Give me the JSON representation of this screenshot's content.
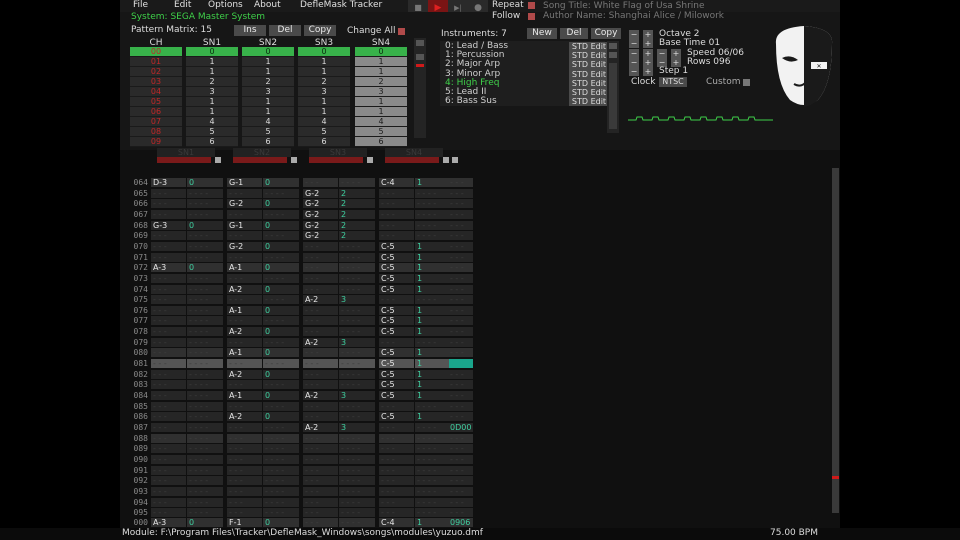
{
  "menu": {
    "file": "File",
    "edit": "Edit",
    "options": "Options",
    "about": "About",
    "app_title": "DefleMask Tracker"
  },
  "transport": {
    "stop": "■",
    "play": "▶",
    "step": "▶|",
    "record": "●"
  },
  "header": {
    "repeat_label": "Repeat",
    "follow_label": "Follow",
    "song_title": "Song Title: White Flag of Usa Shrine",
    "author": "Author Name: Shanghai Alice / Milowork",
    "system": "System: SEGA Master System"
  },
  "matrix": {
    "title": "Pattern Matrix: 15",
    "ins_label": "Ins",
    "del_label": "Del",
    "copy_label": "Copy",
    "change_all": "Change All",
    "headers": [
      "CH",
      "SN1",
      "SN2",
      "SN3",
      "SN4"
    ],
    "rows": [
      [
        "00",
        "0",
        "0",
        "0",
        "0"
      ],
      [
        "01",
        "1",
        "1",
        "1",
        "1"
      ],
      [
        "02",
        "1",
        "1",
        "1",
        "1"
      ],
      [
        "03",
        "2",
        "2",
        "2",
        "2"
      ],
      [
        "04",
        "3",
        "3",
        "3",
        "3"
      ],
      [
        "05",
        "1",
        "1",
        "1",
        "1"
      ],
      [
        "06",
        "1",
        "1",
        "1",
        "1"
      ],
      [
        "07",
        "4",
        "4",
        "4",
        "4"
      ],
      [
        "08",
        "5",
        "5",
        "5",
        "5"
      ],
      [
        "09",
        "6",
        "6",
        "6",
        "6"
      ]
    ]
  },
  "instruments": {
    "title": "Instruments: 7",
    "new_label": "New",
    "del_label": "Del",
    "copy_label": "Copy",
    "items": [
      {
        "name": "0: Lead / Bass",
        "edit": "STD Edit"
      },
      {
        "name": "1: Percussion",
        "edit": "STD Edit"
      },
      {
        "name": "2: Major Arp",
        "edit": "STD Edit"
      },
      {
        "name": "3: Minor Arp",
        "edit": "STD Edit"
      },
      {
        "name": "4: High Freq",
        "edit": "STD Edit"
      },
      {
        "name": "5: Lead II",
        "edit": "STD Edit"
      },
      {
        "name": "6: Bass Sus",
        "edit": "STD Edit"
      }
    ]
  },
  "controls": {
    "octave": "Octave 2",
    "base_time": "Base Time 01",
    "speed": "Speed 06/06",
    "rows": "Rows 096",
    "step": "Step 1",
    "clock_label": "Clock",
    "clock_value": "NTSC",
    "custom_label": "Custom"
  },
  "channels": [
    "SN1",
    "SN2",
    "SN3",
    "SN4"
  ],
  "pattern": {
    "rows": [
      {
        "n": "064",
        "c": [
          [
            "D-3",
            "0"
          ],
          [
            "G-1",
            "0"
          ],
          [
            "",
            ""
          ],
          [
            "C-4",
            "1"
          ]
        ]
      },
      {
        "n": "065",
        "c": [
          [
            "",
            ""
          ],
          [
            "",
            ""
          ],
          [
            "G-2",
            "2"
          ],
          [
            "",
            ""
          ]
        ]
      },
      {
        "n": "066",
        "c": [
          [
            "",
            ""
          ],
          [
            "G-2",
            "0"
          ],
          [
            "G-2",
            "2"
          ],
          [
            "",
            ""
          ]
        ]
      },
      {
        "n": "067",
        "c": [
          [
            "",
            ""
          ],
          [
            "",
            ""
          ],
          [
            "G-2",
            "2"
          ],
          [
            "",
            ""
          ]
        ]
      },
      {
        "n": "068",
        "c": [
          [
            "G-3",
            "0"
          ],
          [
            "G-1",
            "0"
          ],
          [
            "G-2",
            "2"
          ],
          [
            "",
            ""
          ]
        ]
      },
      {
        "n": "069",
        "c": [
          [
            "",
            ""
          ],
          [
            "",
            ""
          ],
          [
            "G-2",
            "2"
          ],
          [
            "",
            ""
          ]
        ]
      },
      {
        "n": "070",
        "c": [
          [
            "",
            ""
          ],
          [
            "G-2",
            "0"
          ],
          [
            "",
            ""
          ],
          [
            "C-5",
            "1"
          ]
        ]
      },
      {
        "n": "071",
        "c": [
          [
            "",
            ""
          ],
          [
            "",
            ""
          ],
          [
            "",
            ""
          ],
          [
            "C-5",
            "1"
          ]
        ]
      },
      {
        "n": "072",
        "c": [
          [
            "A-3",
            "0"
          ],
          [
            "A-1",
            "0"
          ],
          [
            "",
            ""
          ],
          [
            "C-5",
            "1"
          ]
        ]
      },
      {
        "n": "073",
        "c": [
          [
            "",
            ""
          ],
          [
            "",
            ""
          ],
          [
            "",
            ""
          ],
          [
            "C-5",
            "1"
          ]
        ]
      },
      {
        "n": "074",
        "c": [
          [
            "",
            ""
          ],
          [
            "A-2",
            "0"
          ],
          [
            "",
            ""
          ],
          [
            "C-5",
            "1"
          ]
        ]
      },
      {
        "n": "075",
        "c": [
          [
            "",
            ""
          ],
          [
            "",
            ""
          ],
          [
            "A-2",
            "3"
          ],
          [
            "",
            ""
          ]
        ]
      },
      {
        "n": "076",
        "c": [
          [
            "",
            ""
          ],
          [
            "A-1",
            "0"
          ],
          [
            "",
            ""
          ],
          [
            "C-5",
            "1"
          ]
        ]
      },
      {
        "n": "077",
        "c": [
          [
            "",
            ""
          ],
          [
            "",
            ""
          ],
          [
            "",
            ""
          ],
          [
            "C-5",
            "1"
          ]
        ]
      },
      {
        "n": "078",
        "c": [
          [
            "",
            ""
          ],
          [
            "A-2",
            "0"
          ],
          [
            "",
            ""
          ],
          [
            "C-5",
            "1"
          ]
        ]
      },
      {
        "n": "079",
        "c": [
          [
            "",
            ""
          ],
          [
            "",
            ""
          ],
          [
            "A-2",
            "3"
          ],
          [
            "",
            ""
          ]
        ]
      },
      {
        "n": "080",
        "c": [
          [
            "",
            ""
          ],
          [
            "A-1",
            "0"
          ],
          [
            "",
            ""
          ],
          [
            "C-5",
            "1"
          ]
        ]
      },
      {
        "n": "081",
        "c": [
          [
            "",
            ""
          ],
          [
            "",
            ""
          ],
          [
            "",
            ""
          ],
          [
            "C-5",
            "1"
          ]
        ]
      },
      {
        "n": "082",
        "c": [
          [
            "",
            ""
          ],
          [
            "A-2",
            "0"
          ],
          [
            "",
            ""
          ],
          [
            "C-5",
            "1"
          ]
        ]
      },
      {
        "n": "083",
        "c": [
          [
            "",
            ""
          ],
          [
            "",
            ""
          ],
          [
            "",
            ""
          ],
          [
            "C-5",
            "1"
          ]
        ]
      },
      {
        "n": "084",
        "c": [
          [
            "",
            ""
          ],
          [
            "A-1",
            "0"
          ],
          [
            "A-2",
            "3"
          ],
          [
            "C-5",
            "1"
          ]
        ]
      },
      {
        "n": "085",
        "c": [
          [
            "",
            ""
          ],
          [
            "",
            ""
          ],
          [
            "",
            ""
          ],
          [
            "",
            ""
          ]
        ]
      },
      {
        "n": "086",
        "c": [
          [
            "",
            ""
          ],
          [
            "A-2",
            "0"
          ],
          [
            "",
            ""
          ],
          [
            "C-5",
            "1"
          ]
        ]
      },
      {
        "n": "087",
        "c": [
          [
            "",
            ""
          ],
          [
            "",
            ""
          ],
          [
            "A-2",
            "3"
          ],
          [
            "",
            ""
          ]
        ]
      },
      {
        "n": "088",
        "c": [
          [
            "",
            ""
          ],
          [
            "",
            ""
          ],
          [
            "",
            ""
          ],
          [
            "",
            ""
          ]
        ]
      },
      {
        "n": "089",
        "c": [
          [
            "",
            ""
          ],
          [
            "",
            ""
          ],
          [
            "",
            ""
          ],
          [
            "",
            ""
          ]
        ]
      },
      {
        "n": "090",
        "c": [
          [
            "",
            ""
          ],
          [
            "",
            ""
          ],
          [
            "",
            ""
          ],
          [
            "",
            ""
          ]
        ]
      },
      {
        "n": "091",
        "c": [
          [
            "",
            ""
          ],
          [
            "",
            ""
          ],
          [
            "",
            ""
          ],
          [
            "",
            ""
          ]
        ]
      },
      {
        "n": "092",
        "c": [
          [
            "",
            ""
          ],
          [
            "",
            ""
          ],
          [
            "",
            ""
          ],
          [
            "",
            ""
          ]
        ]
      },
      {
        "n": "093",
        "c": [
          [
            "",
            ""
          ],
          [
            "",
            ""
          ],
          [
            "",
            ""
          ],
          [
            "",
            ""
          ]
        ]
      },
      {
        "n": "094",
        "c": [
          [
            "",
            ""
          ],
          [
            "",
            ""
          ],
          [
            "",
            ""
          ],
          [
            "",
            ""
          ]
        ]
      },
      {
        "n": "095",
        "c": [
          [
            "",
            ""
          ],
          [
            "",
            ""
          ],
          [
            "",
            ""
          ],
          [
            "",
            ""
          ]
        ]
      },
      {
        "n": "000",
        "c": [
          [
            "A-3",
            "0"
          ],
          [
            "F-1",
            "0"
          ],
          [
            "",
            ""
          ],
          [
            "C-4",
            "1"
          ]
        ]
      }
    ],
    "effect_087": "0D00",
    "effect_000": "0906"
  },
  "status": {
    "module": "Module: F:\\Program Files\\Tracker\\DefleMask_Windows\\songs\\modules\\yuzuo.dmf",
    "bpm": "75.00 BPM"
  },
  "colors": {
    "accent_green": "#38b24a",
    "note_white": "#e8e8e8",
    "instrument_cyan": "#3fd0a0",
    "header_red": "#c02828",
    "teal_cursor": "#1aa58c"
  }
}
